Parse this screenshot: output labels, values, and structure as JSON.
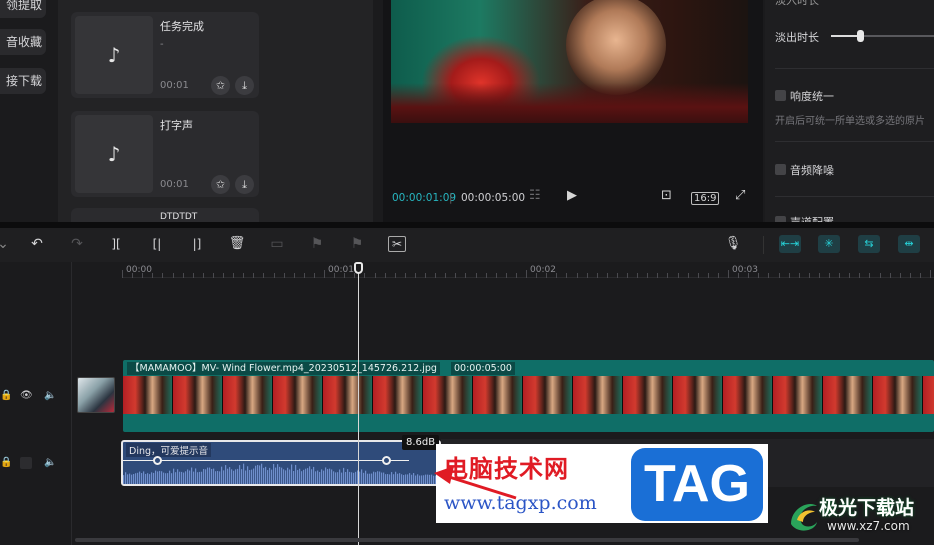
{
  "left_nav": {
    "items": [
      "领提取",
      "音收藏",
      "接下载"
    ]
  },
  "library": {
    "cards": [
      {
        "title": "任务完成",
        "sub": "-",
        "duration": "00:01",
        "icon": "music-note-icon"
      },
      {
        "title": "打字声",
        "sub": "",
        "duration": "00:01",
        "icon": "music-note-icon"
      },
      {
        "title": "DTDTDT",
        "sub": "",
        "duration": "",
        "icon": "music-note-icon"
      }
    ],
    "note_glyph": "♪",
    "star_glyph": "✩",
    "download_glyph": "⤓"
  },
  "player": {
    "current_time": "00:00:01:09",
    "total_time": "00:00:05:00",
    "ratio": "16:9",
    "play_glyph": "▶",
    "crop_glyph": "⊡",
    "fullscreen_glyph": "⤢",
    "grid_glyph": "☷"
  },
  "properties": {
    "top_label": "淡入时长",
    "fade_out_label": "淡出时长",
    "loudness_label": "响度统一",
    "loudness_hint": "开启后可统一所单选或多选的原片",
    "denoise_label": "音频降噪",
    "vocal_label": "声道配置"
  },
  "toolbar": {
    "undo": "↶",
    "redo": "↷",
    "split": "][",
    "split_left": "[|",
    "split_right": "|]",
    "delete": "🗑",
    "freeze": "▭",
    "flag": "⚑",
    "flag2": "⚑",
    "auto": "✂",
    "mic": "🎙",
    "right_buttons": [
      "⇤⇥",
      "✳",
      "⇆",
      "⇹"
    ]
  },
  "timeline": {
    "ruler_labels": [
      "00:00",
      "00:01",
      "00:02",
      "00:03"
    ],
    "video_clip_label": "【MAMAMOO】MV- Wind Flower.mp4_20230512_145726.212.jpg",
    "video_clip_duration": "00:00:05:00",
    "audio_clip_label": "Ding，可爱提示音",
    "volume_tooltip": "8.6dB",
    "lock_glyph": "🔒",
    "eye_glyph": "👁",
    "speaker_glyph": "🔈"
  },
  "watermarks": {
    "cn_site": "电脑技术网",
    "url": "www.tagxp.com",
    "tag": "TAG",
    "logo_cn": "极光下载站",
    "logo_url": "www.xz7.com"
  },
  "colors": {
    "accent": "#27d0d6",
    "video_track": "#0f6e67",
    "audio_track": "#2f4b7a",
    "watermark_red": "#e01b24",
    "watermark_blue": "#1a6fd6"
  }
}
